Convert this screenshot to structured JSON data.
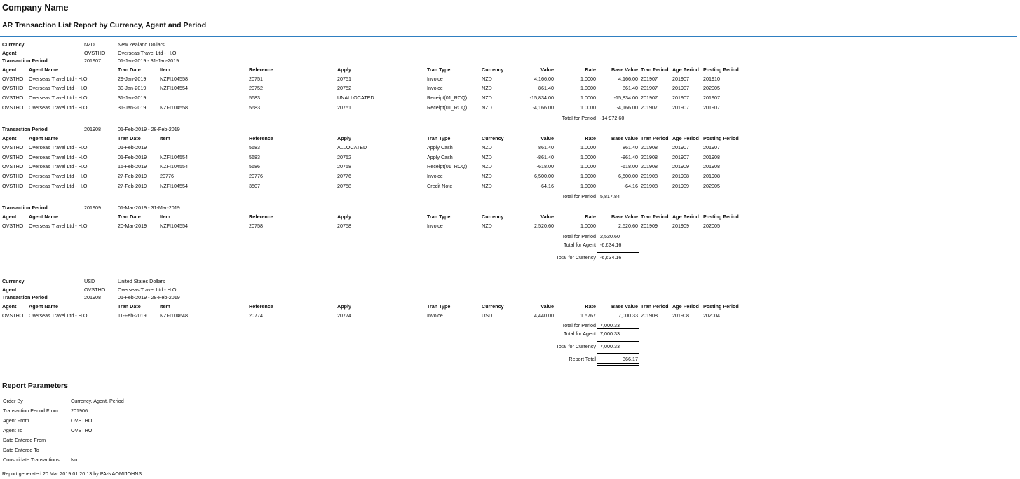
{
  "company_name": "Company Name",
  "report_title": "AR Transaction List Report by Currency, Agent and Period",
  "labels": {
    "currency": "Currency",
    "agent": "Agent",
    "transaction_period": "Transaction Period",
    "total_period": "Total for Period",
    "total_agent": "Total for Agent",
    "total_currency": "Total for Currency",
    "report_total": "Report Total"
  },
  "columns": [
    "Agent",
    "Agent Name",
    "Tran Date",
    "Item",
    "Reference",
    "Apply",
    "Tran Type",
    "Currency",
    "Value",
    "Rate",
    "Base Value",
    "Tran Period",
    "Age Period",
    "Posting Period"
  ],
  "currency_groups": [
    {
      "currency_code": "NZD",
      "currency_name": "New Zealand Dollars",
      "agent_code": "OVSTHO",
      "agent_name": "Overseas Travel Ltd - H.O.",
      "periods": [
        {
          "period": "201907",
          "range": "01-Jan-2019 - 31-Jan-2019",
          "rows": [
            [
              "OVSTHO",
              "Overseas Travel Ltd - H.O.",
              "29-Jan-2019",
              "NZFI104558",
              "20751",
              "20751",
              "Invoice",
              "NZD",
              "4,166.00",
              "1.0000",
              "4,166.00",
              "201907",
              "201907",
              "201910"
            ],
            [
              "OVSTHO",
              "Overseas Travel Ltd - H.O.",
              "30-Jan-2019",
              "NZFI104554",
              "20752",
              "20752",
              "Invoice",
              "NZD",
              "861.40",
              "1.0000",
              "861.40",
              "201907",
              "201907",
              "202005"
            ],
            [
              "OVSTHO",
              "Overseas Travel Ltd - H.O.",
              "31-Jan-2019",
              "",
              "5683",
              "UNALLOCATED",
              "Receipt(01_RCQ)",
              "NZD",
              "-15,834.00",
              "1.0000",
              "-15,834.00",
              "201907",
              "201907",
              "201907"
            ],
            [
              "OVSTHO",
              "Overseas Travel Ltd - H.O.",
              "31-Jan-2019",
              "NZFI104558",
              "5683",
              "20751",
              "Receipt(01_RCQ)",
              "NZD",
              "-4,166.00",
              "1.0000",
              "-4,166.00",
              "201907",
              "201907",
              "201907"
            ]
          ],
          "total": "-14,972.60"
        },
        {
          "period": "201908",
          "range": "01-Feb-2019 - 28-Feb-2019",
          "rows": [
            [
              "OVSTHO",
              "Overseas Travel Ltd - H.O.",
              "01-Feb-2019",
              "",
              "5683",
              "ALLOCATED",
              "Apply Cash",
              "NZD",
              "861.40",
              "1.0000",
              "861.40",
              "201908",
              "201907",
              "201907"
            ],
            [
              "OVSTHO",
              "Overseas Travel Ltd - H.O.",
              "01-Feb-2019",
              "NZFI104554",
              "5683",
              "20752",
              "Apply Cash",
              "NZD",
              "-861.40",
              "1.0000",
              "-861.40",
              "201908",
              "201907",
              "201908"
            ],
            [
              "OVSTHO",
              "Overseas Travel Ltd - H.O.",
              "15-Feb-2019",
              "NZFI104554",
              "5686",
              "20758",
              "Receipt(01_RCQ)",
              "NZD",
              "-618.00",
              "1.0000",
              "-618.00",
              "201908",
              "201909",
              "201908"
            ],
            [
              "OVSTHO",
              "Overseas Travel Ltd - H.O.",
              "27-Feb-2019",
              "20776",
              "20776",
              "20776",
              "Invoice",
              "NZD",
              "6,500.00",
              "1.0000",
              "6,500.00",
              "201908",
              "201908",
              "201908"
            ],
            [
              "OVSTHO",
              "Overseas Travel Ltd - H.O.",
              "27-Feb-2019",
              "NZFI104554",
              "3507",
              "20758",
              "Credit Note",
              "NZD",
              "-64.16",
              "1.0000",
              "-64.16",
              "201908",
              "201909",
              "202005"
            ]
          ],
          "total": "5,817.84"
        },
        {
          "period": "201909",
          "range": "01-Mar-2019 - 31-Mar-2019",
          "rows": [
            [
              "OVSTHO",
              "Overseas Travel Ltd - H.O.",
              "20-Mar-2019",
              "NZFI104554",
              "20758",
              "20758",
              "Invoice",
              "NZD",
              "2,520.60",
              "1.0000",
              "2,520.60",
              "201909",
              "201909",
              "202005"
            ]
          ],
          "total": "2,520.60"
        }
      ],
      "total_agent": "-6,634.16",
      "total_currency": "-6,634.16"
    },
    {
      "currency_code": "USD",
      "currency_name": "United States Dollars",
      "agent_code": "OVSTHO",
      "agent_name": "Overseas Travel Ltd - H.O.",
      "periods": [
        {
          "period": "201908",
          "range": "01-Feb-2019 - 28-Feb-2019",
          "rows": [
            [
              "OVSTHO",
              "Overseas Travel Ltd - H.O.",
              "11-Feb-2019",
              "NZFI104648",
              "20774",
              "20774",
              "Invoice",
              "USD",
              "4,440.00",
              "1.5767",
              "7,000.33",
              "201908",
              "201908",
              "202004"
            ]
          ],
          "total": "7,000.33"
        }
      ],
      "total_agent": "7,000.33",
      "total_currency": "7,000.33"
    }
  ],
  "report_total": "366.17",
  "parameters": {
    "title": "Report Parameters",
    "items": [
      {
        "label": "Order By",
        "value": "Currency, Agent, Period"
      },
      {
        "label": "Transaction Period From",
        "value": "201906"
      },
      {
        "label": "Agent From",
        "value": "OVSTHO"
      },
      {
        "label": "Agent To",
        "value": "OVSTHO"
      },
      {
        "label": "Date Entered From",
        "value": ""
      },
      {
        "label": "Date Entered To",
        "value": ""
      },
      {
        "label": "Consolidate Transactions",
        "value": "No"
      }
    ]
  },
  "footer": "Report generated 20 Mar 2019 01:20:13 by PA-NAOMIJOHNS"
}
